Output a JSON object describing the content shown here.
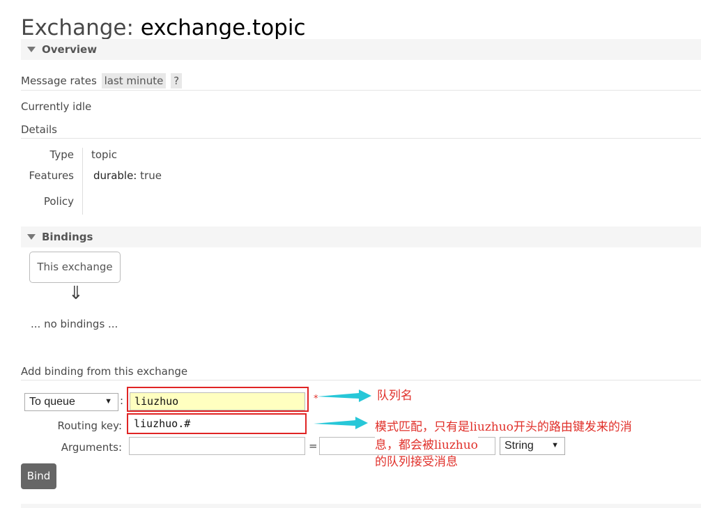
{
  "header": {
    "prefix": "Exchange: ",
    "name": "exchange.topic"
  },
  "overview": {
    "section_label": "Overview",
    "message_rates_label": "Message rates",
    "message_rates_value": "last minute",
    "help_label": "?",
    "status": "Currently idle",
    "details_label": "Details",
    "details": {
      "type_key": "Type",
      "type_value": "topic",
      "features_key": "Features",
      "features_name": "durable:",
      "features_value": "true",
      "policy_key": "Policy"
    }
  },
  "bindings": {
    "section_label": "Bindings",
    "source_box": "This exchange",
    "arrow": "⇓",
    "empty_text": "... no bindings ..."
  },
  "add_binding": {
    "heading": "Add binding from this exchange",
    "destination_type": "To queue",
    "destination_caret": "▼",
    "colon": ":",
    "destination_value": "liuzhuo",
    "required_mark": "*",
    "routing_key_label": "Routing key:",
    "routing_key_value": "liuzhuo.#",
    "arguments_label": "Arguments:",
    "arguments_equals": "=",
    "arguments_type": "String",
    "arguments_caret": "▼",
    "bind_button": "Bind"
  },
  "annotations": {
    "queue_note": "队列名",
    "routing_note_line1": "模式匹配，只有是liuzhuo开头的路由键发来的消",
    "routing_note_line2": "息，都会被liuzhuo",
    "routing_note_line3": "的队列接受消息"
  },
  "colors": {
    "annotation_red": "#e0302a",
    "arrow_cyan": "#27c7d8",
    "input_highlight": "#ffffc0"
  }
}
